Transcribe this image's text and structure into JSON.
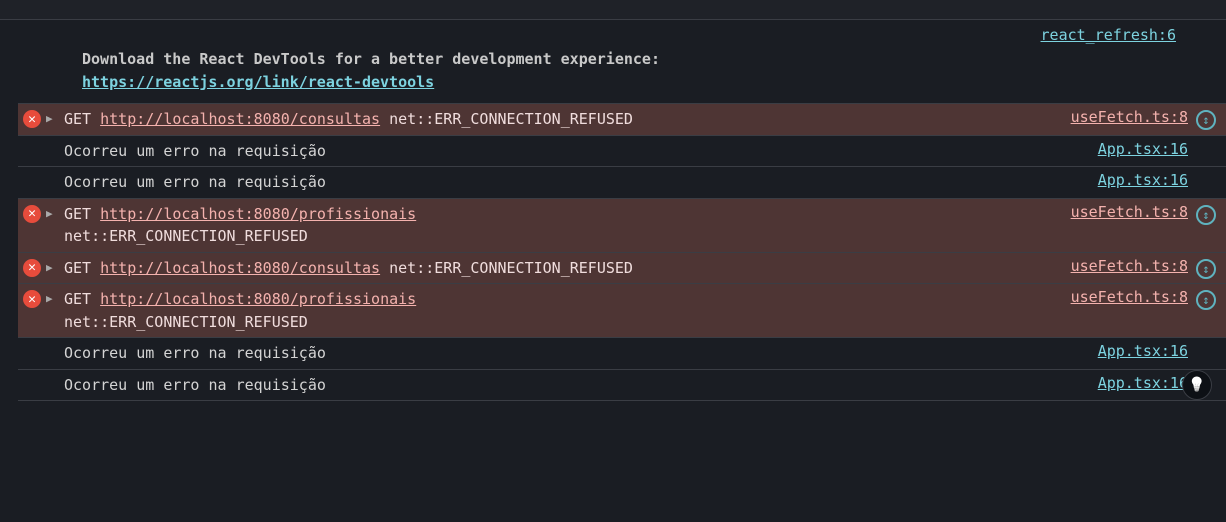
{
  "topLink": {
    "label": "react_refresh:6"
  },
  "intro": {
    "text": "Download the React DevTools for a better development experience:",
    "link": "https://reactjs.org/link/react-devtools"
  },
  "rows": [
    {
      "type": "error",
      "expand": true,
      "method": "GET ",
      "url": "http://localhost:8080/consultas",
      "tail": " net::ERR_CONNECTION_REFUSED",
      "src": "useFetch.ts:8",
      "replay": true
    },
    {
      "type": "info",
      "text": "Ocorreu um erro na requisição",
      "src": "App.tsx:16"
    },
    {
      "type": "info",
      "text": "Ocorreu um erro na requisição",
      "src": "App.tsx:16"
    },
    {
      "type": "error",
      "expand": true,
      "method": "GET ",
      "url": "http://localhost:8080/profissionais",
      "tail2": "net::ERR_CONNECTION_REFUSED",
      "src": "useFetch.ts:8",
      "replay": true
    },
    {
      "type": "error",
      "expand": true,
      "method": "GET ",
      "url": "http://localhost:8080/consultas",
      "tail": " net::ERR_CONNECTION_REFUSED",
      "src": "useFetch.ts:8",
      "replay": true
    },
    {
      "type": "error",
      "expand": true,
      "method": "GET ",
      "url": "http://localhost:8080/profissionais",
      "tail2": "net::ERR_CONNECTION_REFUSED",
      "src": "useFetch.ts:8",
      "replay": true
    },
    {
      "type": "info",
      "text": "Ocorreu um erro na requisição",
      "src": "App.tsx:16"
    },
    {
      "type": "info",
      "text": "Ocorreu um erro na requisição",
      "src": "App.tsx:16"
    }
  ]
}
